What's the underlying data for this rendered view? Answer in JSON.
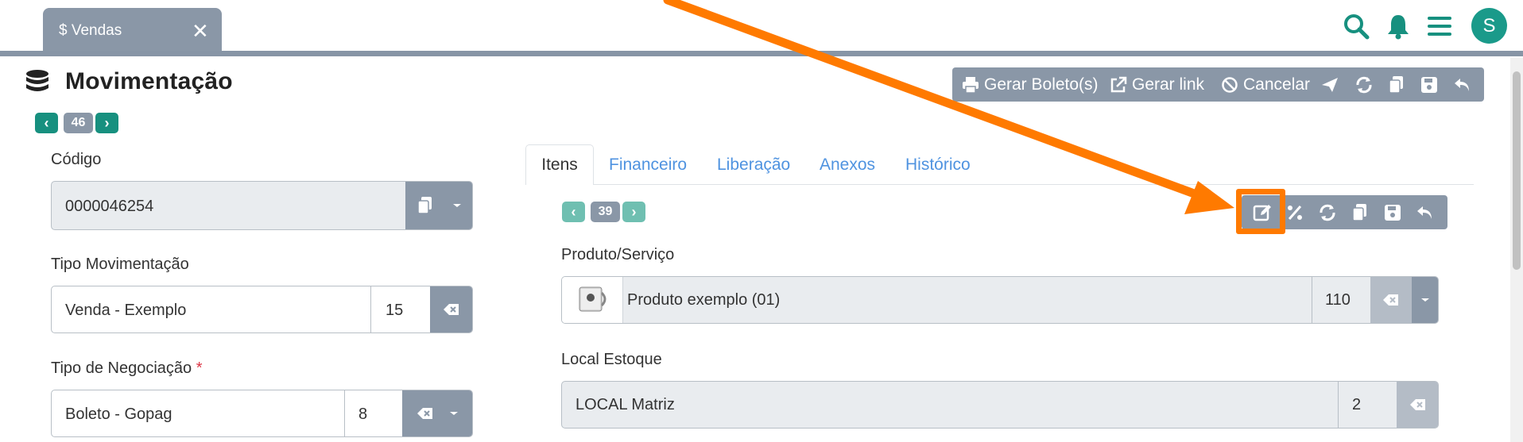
{
  "app": {
    "tab_label": "$ Vendas",
    "tab_close": "✕",
    "avatar_letter": "S"
  },
  "header": {
    "title": "Movimentação",
    "pager_count": "46"
  },
  "toolbar": {
    "gerar_boleto": "Gerar Boleto(s)",
    "gerar_link": "Gerar link",
    "cancelar": "Cancelar"
  },
  "form": {
    "codigo_label": "Código",
    "codigo_value": "0000046254",
    "tipo_mov_label": "Tipo Movimentação",
    "tipo_mov_value": "Venda - Exemplo",
    "tipo_mov_code": "15",
    "tipo_neg_label": "Tipo de Negociação",
    "required_mark": "*",
    "tipo_neg_value": "Boleto - Gopag",
    "tipo_neg_code": "8"
  },
  "tabs": [
    "Itens",
    "Financeiro",
    "Liberação",
    "Anexos",
    "Histórico"
  ],
  "items": {
    "pager_count": "39",
    "produto_label": "Produto/Serviço",
    "produto_value": "Produto exemplo (01)",
    "produto_code": "110",
    "local_label": "Local Estoque",
    "local_value": "LOCAL Matriz",
    "local_code": "2"
  },
  "colors": {
    "accent_teal": "#17907f",
    "slate": "#8a97a7",
    "link_blue": "#4f93e0",
    "annotation_orange": "#ff7a00"
  }
}
